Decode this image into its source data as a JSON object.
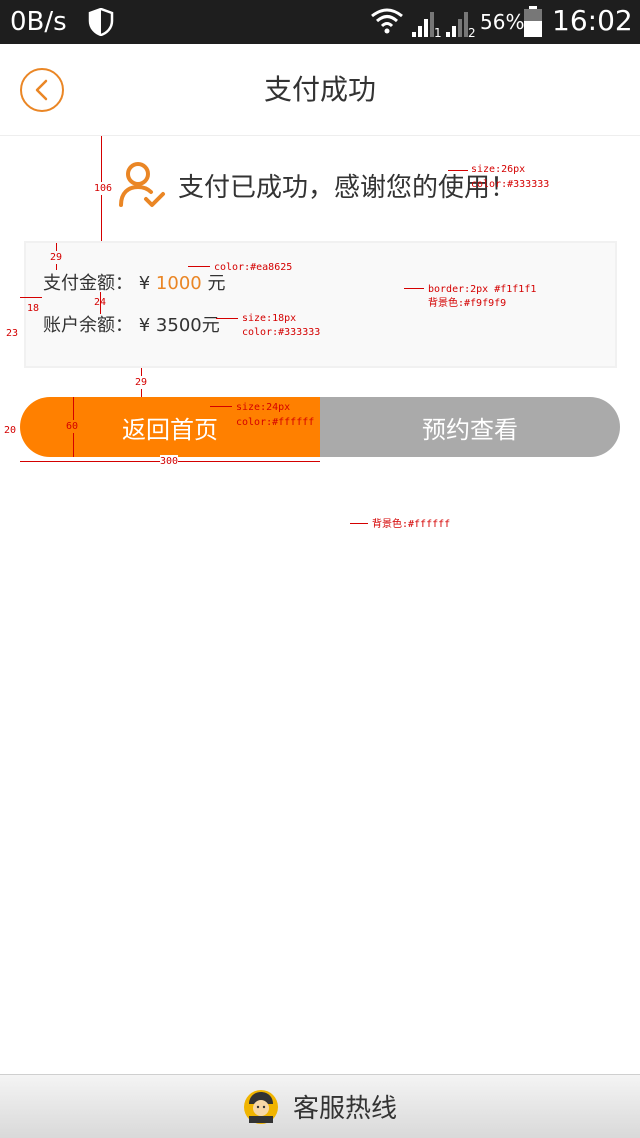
{
  "status_bar": {
    "net_speed": "0B/s",
    "battery_percent": "56%",
    "time": "16:02",
    "sim1": "1",
    "sim2": "2"
  },
  "header": {
    "title": "支付成功"
  },
  "success": {
    "message": "支付已成功，感谢您的使用！"
  },
  "info": {
    "paid_label": "支付金额：",
    "currency": "¥",
    "paid_amount": "1000",
    "paid_unit": "元",
    "balance_label": "账户余额：",
    "balance_amount": "3500元"
  },
  "buttons": {
    "home_label": "返回首页",
    "view_label": "预约查看"
  },
  "footer": {
    "label": "客服热线"
  },
  "annotations": {
    "dim_106": "106",
    "dim_29_top": "29",
    "dim_24": "24",
    "dim_18": "18",
    "dim_23": "23",
    "dim_29_bottom": "29",
    "dim_20": "20",
    "dim_60": "60",
    "dim_300": "300",
    "note_title_size": "size:26px",
    "note_title_color": "color:#333333",
    "note_amount_color": "color:#ea8625",
    "note_border": "border:2px #f1f1f1",
    "note_box_bg": "背景色:#f9f9f9",
    "note_text_size": "size:18px",
    "note_text_color": "color:#333333",
    "note_btn_size": "size:24px",
    "note_btn_color": "color:#ffffff",
    "note_page_bg": "背景色:#ffffff"
  },
  "colors": {
    "accent": "#ea8625",
    "button_primary": "#ff8000",
    "button_secondary": "#aaaaaa",
    "text": "#333333",
    "box_bg": "#f9f9f9",
    "box_border": "#f1f1f1"
  },
  "icons": {
    "back": "chevron-left-icon",
    "success": "user-check-icon",
    "footer": "customer-service-icon"
  }
}
